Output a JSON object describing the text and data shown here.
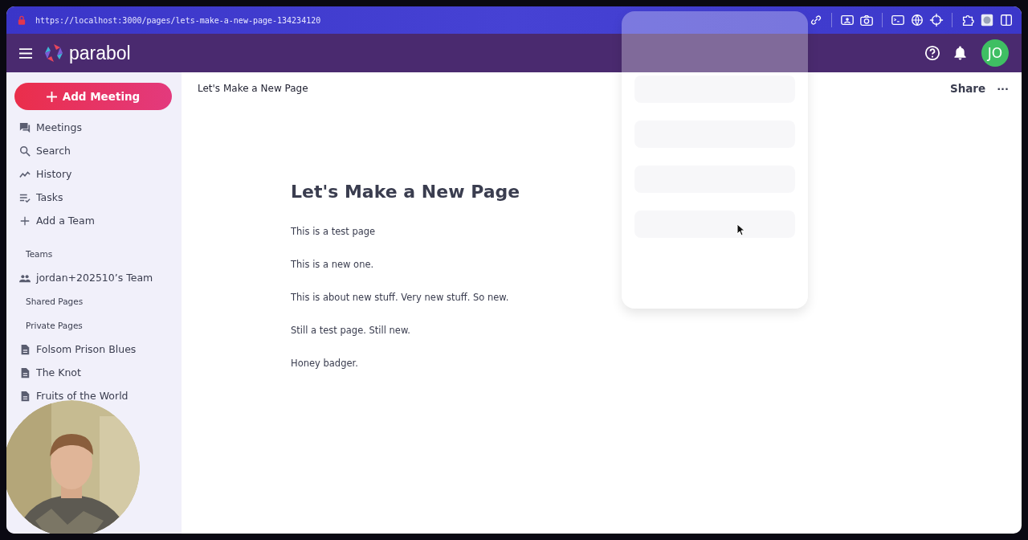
{
  "browser": {
    "url": "https://localhost:3000/pages/lets-make-a-new-page-134234120"
  },
  "header": {
    "brand": "parabol",
    "avatar": "JO"
  },
  "sidebar": {
    "add_button": "Add Meeting",
    "nav": [
      {
        "label": "Meetings"
      },
      {
        "label": "Search"
      },
      {
        "label": "History"
      },
      {
        "label": "Tasks"
      },
      {
        "label": "Add a Team"
      }
    ],
    "teams_heading": "Teams",
    "teams": [
      {
        "label": "jordan+202510’s Team"
      }
    ],
    "shared_heading": "Shared Pages",
    "private_heading": "Private Pages",
    "pages": [
      {
        "label": "Folsom Prison Blues"
      },
      {
        "label": "The Knot"
      },
      {
        "label": "Fruits of the World"
      }
    ]
  },
  "document": {
    "breadcrumb": "Let's Make a New Page",
    "share": "Share",
    "more": "···",
    "title": "Let's Make a New Page",
    "paragraphs": [
      "This is a test page",
      "This is a new one.",
      "This is about new stuff. Very new stuff. So new.",
      "Still a test page. Still new.",
      "Honey badger."
    ]
  }
}
